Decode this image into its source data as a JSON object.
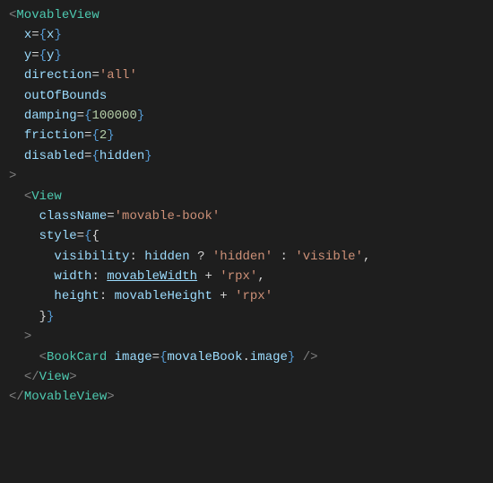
{
  "code": {
    "l1": {
      "b1": "<",
      "tag": "MovableView"
    },
    "l2": {
      "indent": "  ",
      "attr": "x",
      "eq": "=",
      "br1": "{",
      "var": "x",
      "br2": "}"
    },
    "l3": {
      "indent": "  ",
      "attr": "y",
      "eq": "=",
      "br1": "{",
      "var": "y",
      "br2": "}"
    },
    "l4": {
      "indent": "  ",
      "attr": "direction",
      "eq": "=",
      "str": "'all'"
    },
    "l5": {
      "indent": "  ",
      "attr": "outOfBounds"
    },
    "l6": {
      "indent": "  ",
      "attr": "damping",
      "eq": "=",
      "br1": "{",
      "num": "100000",
      "br2": "}"
    },
    "l7": {
      "indent": "  ",
      "attr": "friction",
      "eq": "=",
      "br1": "{",
      "num": "2",
      "br2": "}"
    },
    "l8": {
      "indent": "  ",
      "attr": "disabled",
      "eq": "=",
      "br1": "{",
      "var": "hidden",
      "br2": "}"
    },
    "l9": {
      "b": ">"
    },
    "l10": {
      "indent": "  ",
      "b1": "<",
      "tag": "View"
    },
    "l11": {
      "indent": "    ",
      "attr": "className",
      "eq": "=",
      "str": "'movable-book'"
    },
    "l12": {
      "indent": "    ",
      "attr": "style",
      "eq": "=",
      "br1": "{",
      "cur1": "{"
    },
    "l13": {
      "indent": "      ",
      "prop": "visibility",
      "colon": ": ",
      "var": "hidden",
      "q": " ? ",
      "s1": "'hidden'",
      "c": " : ",
      "s2": "'visible'",
      "comma": ","
    },
    "l14": {
      "indent": "      ",
      "prop": "width",
      "colon": ": ",
      "var": "movableWidth",
      "plus": " + ",
      "str": "'rpx'",
      "comma": ","
    },
    "l15": {
      "indent": "      ",
      "prop": "height",
      "colon": ": ",
      "var": "movableHeight",
      "plus": " + ",
      "str": "'rpx'"
    },
    "l16": {
      "indent": "    ",
      "cur": "}",
      "br": "}"
    },
    "l17": {
      "indent": "  ",
      "b": ">"
    },
    "l18": {
      "indent": "    ",
      "b1": "<",
      "tag": "BookCard",
      "sp": " ",
      "attr": "image",
      "eq": "=",
      "br1": "{",
      "var1": "movaleBook",
      "dot": ".",
      "var2": "image",
      "br2": "}",
      "sp2": " ",
      "sl": "/",
      "b2": ">"
    },
    "l19": {
      "indent": "  ",
      "b1": "<",
      "sl": "/",
      "tag": "View",
      "b2": ">"
    },
    "l20": {
      "b1": "<",
      "sl": "/",
      "tag": "MovableView",
      "b2": ">"
    }
  }
}
